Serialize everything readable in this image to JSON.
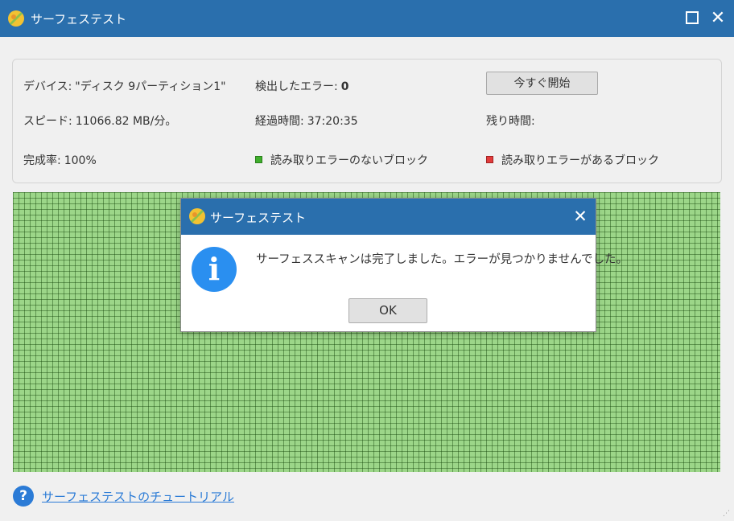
{
  "window": {
    "title": "サーフェステスト",
    "icon": "app-logo-icon",
    "maximize_icon": "maximize-icon",
    "close_icon": "close-icon",
    "close_glyph": "✕"
  },
  "info": {
    "device_label": "デバイス:",
    "device_value": "\"ディスク 9パーティション1\"",
    "errors_label": "検出したエラー:",
    "errors_value": "0",
    "start_button": "今すぐ開始",
    "speed_label": "スピード:",
    "speed_value": "11066.82 MB/分。",
    "elapsed_label": "経過時間:",
    "elapsed_value": "37:20:35",
    "remaining_label": "残り時間:",
    "remaining_value": "",
    "completion_label": "完成率:",
    "completion_value": "100%",
    "legend_ok": "読み取りエラーのないブロック",
    "legend_error": "読み取りエラーがあるブロック",
    "legend_ok_color": "#3fae2c",
    "legend_error_color": "#e23b3b"
  },
  "block_map": {
    "status": "all blocks without read errors",
    "block_color": "#3e9a2d"
  },
  "footer": {
    "help_icon": "question-circle-icon",
    "help_glyph": "?",
    "tutorial_link": "サーフェステストのチュートリアル"
  },
  "dialog": {
    "title": "サーフェステスト",
    "icon": "info-icon",
    "icon_glyph": "i",
    "close_glyph": "✕",
    "message": "サーフェススキャンは完了しました。エラーが見つかりませんでした。",
    "ok_button": "OK"
  }
}
